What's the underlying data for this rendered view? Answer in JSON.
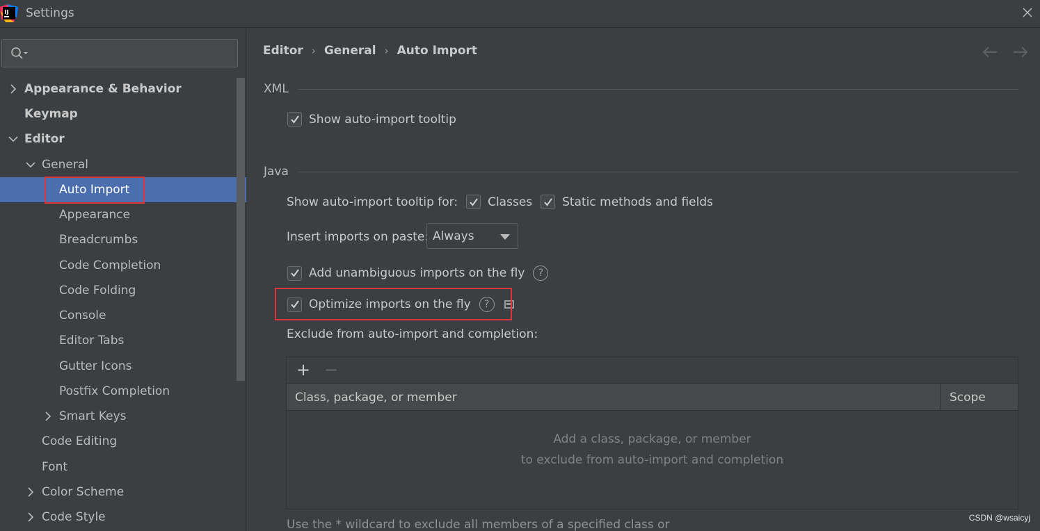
{
  "window": {
    "title": "Settings"
  },
  "search": {
    "placeholder": ""
  },
  "sidebar": {
    "items": [
      {
        "label": "Appearance & Behavior"
      },
      {
        "label": "Keymap"
      },
      {
        "label": "Editor"
      },
      {
        "label": "General"
      },
      {
        "label": "Auto Import"
      },
      {
        "label": "Appearance"
      },
      {
        "label": "Breadcrumbs"
      },
      {
        "label": "Code Completion"
      },
      {
        "label": "Code Folding"
      },
      {
        "label": "Console"
      },
      {
        "label": "Editor Tabs"
      },
      {
        "label": "Gutter Icons"
      },
      {
        "label": "Postfix Completion"
      },
      {
        "label": "Smart Keys"
      },
      {
        "label": "Code Editing"
      },
      {
        "label": "Font"
      },
      {
        "label": "Color Scheme"
      },
      {
        "label": "Code Style"
      }
    ]
  },
  "breadcrumb": {
    "items": [
      "Editor",
      "General",
      "Auto Import"
    ],
    "separator": "›"
  },
  "xml": {
    "title": "XML",
    "show_tooltip_label": "Show auto-import tooltip"
  },
  "java": {
    "title": "Java",
    "tooltip_for_label": "Show auto-import tooltip for:",
    "classes_label": "Classes",
    "static_label": "Static methods and fields",
    "insert_label": "Insert imports on paste:",
    "insert_value": "Always",
    "unambiguous_label": "Add unambiguous imports on the fly",
    "optimize_label": "Optimize imports on the fly",
    "exclude_label": "Exclude from auto-import and completion:"
  },
  "table": {
    "add_label": "+",
    "remove_label": "−",
    "col1": "Class, package, or member",
    "col2": "Scope",
    "empty_line1": "Add a class, package, or member",
    "empty_line2": "to exclude from auto-import and completion"
  },
  "footer": {
    "text": "Use the * wildcard to exclude all members of a specified class or"
  },
  "watermark": {
    "text": "CSDN @wsaicyj"
  },
  "colors": {
    "background": "#3c3f41",
    "selection": "#4b6eaf",
    "highlight": "#e0353d"
  }
}
